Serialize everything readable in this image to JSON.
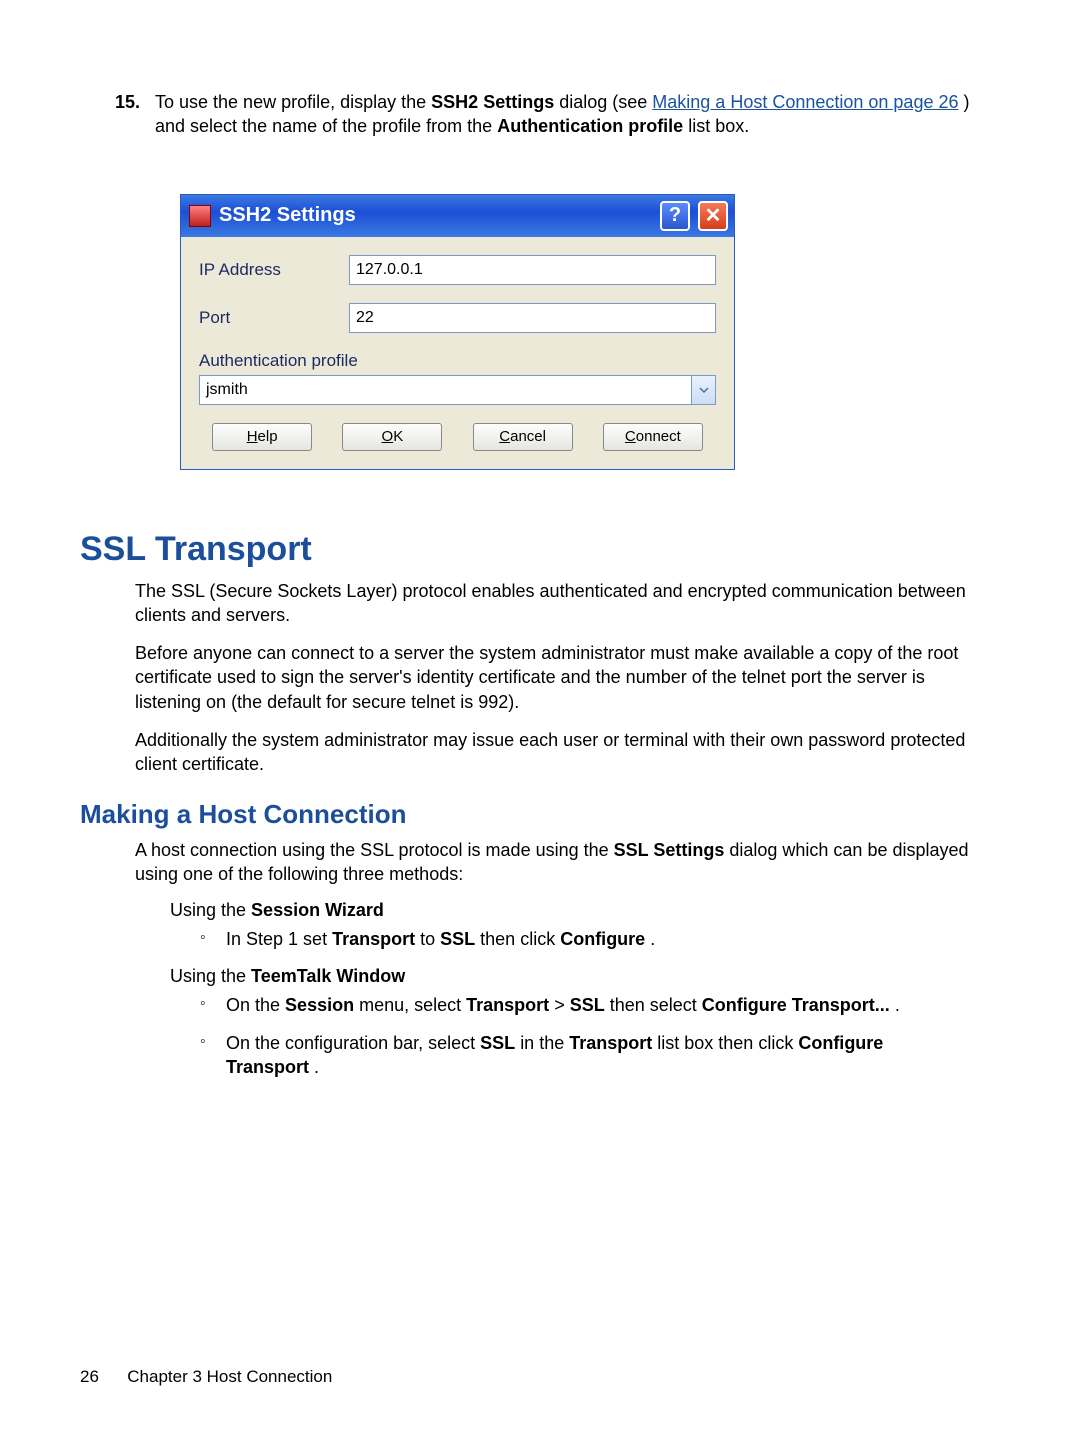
{
  "step": {
    "number": "15.",
    "text_pre": "To use the new profile, display the ",
    "bold1": "SSH2 Settings",
    "text_mid1": " dialog (see ",
    "link": "Making a Host Connection on page 26",
    "text_mid2": ") and select the name of the profile from the ",
    "bold2": "Authentication profile",
    "text_end": " list box."
  },
  "dialog": {
    "title": "SSH2 Settings",
    "ip_label": "IP Address",
    "ip_value": "127.0.0.1",
    "port_label": "Port",
    "port_value": "22",
    "auth_label": "Authentication profile",
    "auth_value": "jsmith",
    "buttons": {
      "help": "Help",
      "ok": "OK",
      "cancel": "Cancel",
      "connect": "Connect"
    }
  },
  "ssl": {
    "heading": "SSL Transport",
    "p1": "The SSL (Secure Sockets Layer) protocol enables authenticated and encrypted communication between clients and servers.",
    "p2": "Before anyone can connect to a server the system administrator must make available a copy of the root certificate used to sign the server's identity certificate and the number of the telnet port the server is listening on (the default for secure telnet is 992).",
    "p3": "Additionally the system administrator may issue each user or terminal with their own password protected client certificate."
  },
  "making": {
    "heading": "Making a Host Connection",
    "intro_pre": "A host connection using the SSL protocol is made using the ",
    "intro_bold": "SSL Settings",
    "intro_post": " dialog which can be displayed using one of the following three methods:",
    "using1_pre": "Using the ",
    "using1_bold": "Session Wizard",
    "bullet1_pre": "In Step 1 set ",
    "bullet1_b1": "Transport",
    "bullet1_mid": " to ",
    "bullet1_b2": "SSL",
    "bullet1_mid2": " then click ",
    "bullet1_b3": "Configure",
    "bullet1_end": ".",
    "using2_pre": "Using the ",
    "using2_bold": "TeemTalk Window",
    "bullet2_pre": "On the ",
    "bullet2_b1": "Session",
    "bullet2_mid1": " menu, select ",
    "bullet2_b2": "Transport",
    "bullet2_caret": " > ",
    "bullet2_b3": "SSL",
    "bullet2_mid2": " then select ",
    "bullet2_b4": "Configure Transport...",
    "bullet2_end": ".",
    "bullet3_pre": "On the configuration bar, select ",
    "bullet3_b1": "SSL",
    "bullet3_mid1": " in the ",
    "bullet3_b2": "Transport",
    "bullet3_mid2": " list box then click ",
    "bullet3_b3": "Configure Transport",
    "bullet3_end": "."
  },
  "footer": {
    "page": "26",
    "chapter": "Chapter 3   Host Connection"
  }
}
